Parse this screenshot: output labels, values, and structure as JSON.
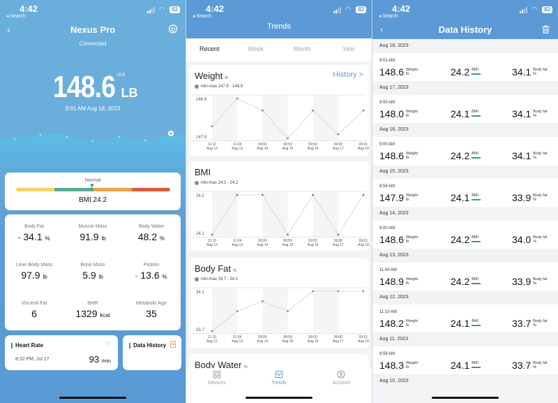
{
  "status_bar": {
    "time": "4:42",
    "back_app": "◂ Search",
    "battery": "82"
  },
  "device_screen": {
    "back_icon": "‹",
    "title": "Nexus Pro",
    "connection_status": "Connected",
    "weight_value": "148.6",
    "weight_unit": "LB",
    "weight_delta": "↑0.6",
    "measured_at": "9:01 AM  Aug 18, 2023",
    "bmi_card": {
      "category": "Normal",
      "label": "BMI 24.2",
      "segment_colors": [
        "#f5d36b",
        "#5bab95",
        "#f2a04e",
        "#dd5b3c"
      ],
      "marker_position_pct": 49
    },
    "metrics": [
      {
        "label": "Body Fat",
        "value": "34.1",
        "unit": "%",
        "indicator_color": "#f29b3a"
      },
      {
        "label": "Muscle Mass",
        "value": "91.9",
        "unit": "lb"
      },
      {
        "label": "Body Water",
        "value": "48.2",
        "unit": "%"
      },
      {
        "label": "Lean Body Mass",
        "value": "97.9",
        "unit": "lb"
      },
      {
        "label": "Bone Mass",
        "value": "5.9",
        "unit": "lb"
      },
      {
        "label": "Protein",
        "value": "13.6",
        "unit": "%",
        "indicator_color": "#f5c542"
      },
      {
        "label": "Visceral Fat",
        "value": "6",
        "unit": ""
      },
      {
        "label": "BMR",
        "value": "1329",
        "unit": "kcal"
      },
      {
        "label": "Metabolic Age",
        "value": "35",
        "unit": ""
      }
    ],
    "heart_rate": {
      "title": "Heart Rate",
      "time": "8:32 PM, Jul 27",
      "value": "93",
      "unit": "/min"
    },
    "data_history": {
      "title": "Data History"
    }
  },
  "trends_screen": {
    "title": "Trends",
    "tabs": [
      "Recent",
      "Week",
      "Month",
      "Year"
    ],
    "active_tab": "Recent",
    "history_link": "History >",
    "cards": [
      {
        "name": "Weight",
        "unit": "lb",
        "minmax": "min-max 147.9 - 148.9",
        "has_history_link": true
      },
      {
        "name": "BMI",
        "unit": "",
        "minmax": "min-max 24.1 - 24.2"
      },
      {
        "name": "Body Fat",
        "unit": "%",
        "minmax": "min-max 33.7 - 34.1"
      },
      {
        "name": "Body Water",
        "unit": "%"
      }
    ],
    "bottom_nav": [
      {
        "label": "Devices",
        "icon": "grid-icon"
      },
      {
        "label": "Trends",
        "icon": "trend-chart-icon",
        "active": true
      },
      {
        "label": "Account",
        "icon": "user-circle-icon"
      }
    ]
  },
  "chart_data": [
    {
      "type": "line",
      "title": "Weight",
      "unit": "lb",
      "x": [
        "11:10\nAug 12",
        "11:04\nAug 13",
        "09:00\nAug 14",
        "08:59\nAug 15",
        "09:00\nAug 16",
        "09:00\nAug 17",
        "09:01\nAug 18"
      ],
      "values": [
        148.2,
        148.9,
        148.6,
        147.9,
        148.6,
        148.0,
        148.6
      ],
      "ylim": [
        147.9,
        148.9
      ],
      "ytick_labels": [
        "148.9",
        "147.9"
      ],
      "point_color": "#6aaa2a"
    },
    {
      "type": "line",
      "title": "BMI",
      "unit": "",
      "x": [
        "11:10\nAug 12",
        "11:04\nAug 13",
        "09:00\nAug 14",
        "08:59\nAug 15",
        "09:00\nAug 16",
        "09:00\nAug 17",
        "09:01\nAug 18"
      ],
      "values": [
        24.1,
        24.2,
        24.2,
        24.1,
        24.2,
        24.1,
        24.2
      ],
      "ylim": [
        24.1,
        24.2
      ],
      "ytick_labels": [
        "24.2",
        "24.1"
      ],
      "point_color": "#2f9c7a"
    },
    {
      "type": "line",
      "title": "Body Fat",
      "unit": "%",
      "x": [
        "11:10\nAug 12",
        "11:04\nAug 13",
        "09:00\nAug 14",
        "08:59\nAug 15",
        "09:00\nAug 16",
        "09:00\nAug 17",
        "09:01\nAug 18"
      ],
      "values": [
        33.7,
        33.9,
        34.0,
        33.9,
        34.1,
        34.1,
        34.1
      ],
      "ylim": [
        33.7,
        34.1
      ],
      "ytick_labels": [
        "34.1",
        "33.7"
      ],
      "point_color": "#6aaa2a"
    }
  ],
  "history_screen": {
    "back_icon": "‹",
    "title": "Data History",
    "labels": {
      "weight": "Weight",
      "weight_unit": "lb",
      "bmi": "BMI",
      "body_fat": "Body fat",
      "body_fat_unit": "%"
    },
    "entries": [
      {
        "date": "Aug 18, 2023",
        "time": "9:01 AM",
        "weight": "148.6",
        "bmi": "24.2",
        "body_fat": "34.1"
      },
      {
        "date": "Aug 17, 2023",
        "time": "9:00 AM",
        "weight": "148.0",
        "bmi": "24.1",
        "body_fat": "34.1"
      },
      {
        "date": "Aug 16, 2023",
        "time": "9:00 AM",
        "weight": "148.6",
        "bmi": "24.2",
        "body_fat": "34.1"
      },
      {
        "date": "Aug 15, 2023",
        "time": "8:59 AM",
        "weight": "147.9",
        "bmi": "24.1",
        "body_fat": "33.9"
      },
      {
        "date": "Aug 14, 2023",
        "time": "9:00 AM",
        "weight": "148.6",
        "bmi": "24.2",
        "body_fat": "34.0"
      },
      {
        "date": "Aug 13, 2023",
        "time": "11:04 AM",
        "weight": "148.9",
        "bmi": "24.2",
        "body_fat": "33.9"
      },
      {
        "date": "Aug 12, 2023",
        "time": "11:10 AM",
        "weight": "148.2",
        "bmi": "24.1",
        "body_fat": "33.7"
      },
      {
        "date": "Aug 11, 2023",
        "time": "8:59 AM",
        "weight": "148.3",
        "bmi": "24.1",
        "body_fat": "33.7"
      },
      {
        "date": "Aug 10, 2023"
      }
    ]
  }
}
